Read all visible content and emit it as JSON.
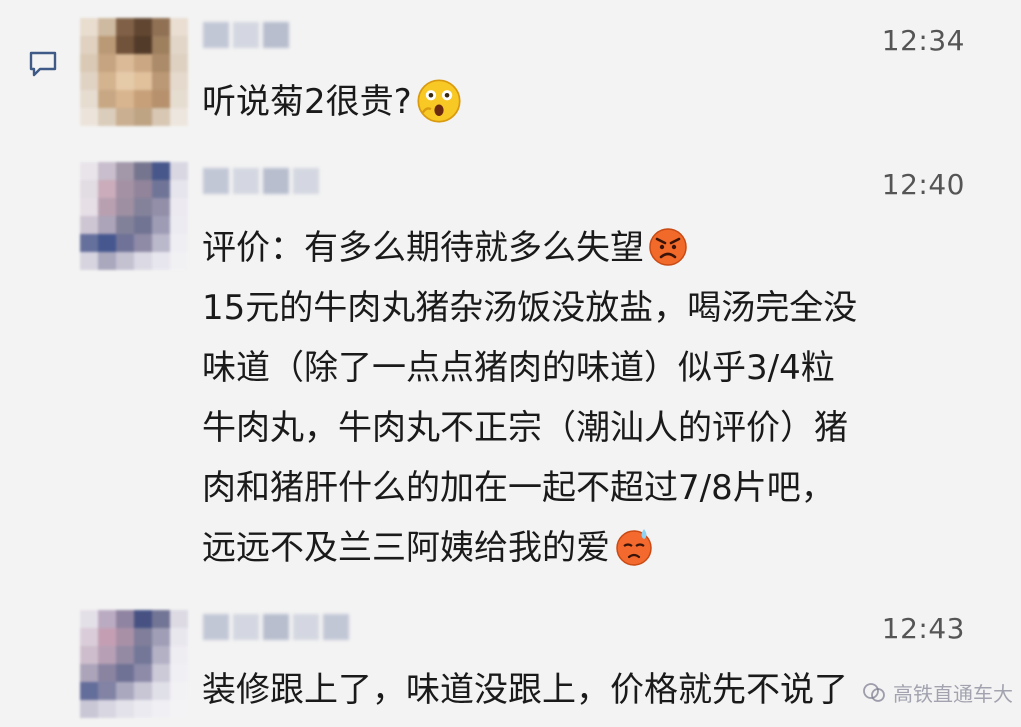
{
  "messages": [
    {
      "time": "12:34",
      "lines": [
        "听说菊2很贵?"
      ],
      "emoji": "shocked-face-icon"
    },
    {
      "time": "12:40",
      "lines": [
        "评价：有多么期待就多么失望",
        "15元的牛肉丸猪杂汤饭没放盐，喝汤完全没",
        "味道（除了一点点猪肉的味道）似乎3/4粒",
        "牛肉丸，牛肉丸不正宗（潮汕人的评价）猪",
        "肉和猪肝什么的加在一起不超过7/8片吧，",
        "远远不及兰三阿姨给我的爱"
      ],
      "emojis": [
        "angry-face-icon",
        "sweating-face-icon"
      ]
    },
    {
      "time": "12:43",
      "lines": [
        "装修跟上了，味道没跟上，价格就先不说了"
      ]
    }
  ],
  "watermark": {
    "text": "高铁直通车大"
  },
  "colors": {
    "background": "#f3f3f3",
    "text": "#1a1a1a",
    "timestamp": "#555555",
    "quote_icon": "#3f5a86"
  }
}
